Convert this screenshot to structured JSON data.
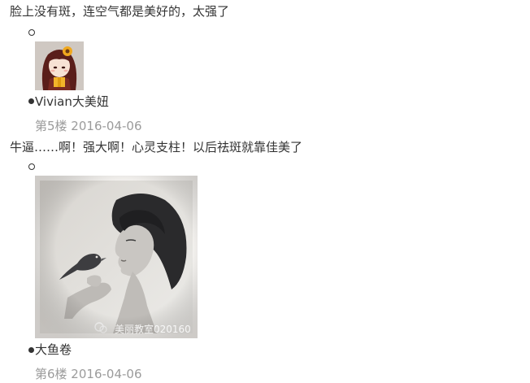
{
  "comments": [
    {
      "text": "脸上没有斑，连空气都是美好的，太强了"
    },
    {
      "username": "Vivian大美妞",
      "meta": "第5楼 2016-04-06",
      "text": "牛逼……啊！强大啊！心灵支柱！以后祛斑就靠佳美了"
    },
    {
      "username": "大鱼卷",
      "meta": "第6楼 2016-04-06",
      "watermark": "美丽教室020160"
    }
  ]
}
